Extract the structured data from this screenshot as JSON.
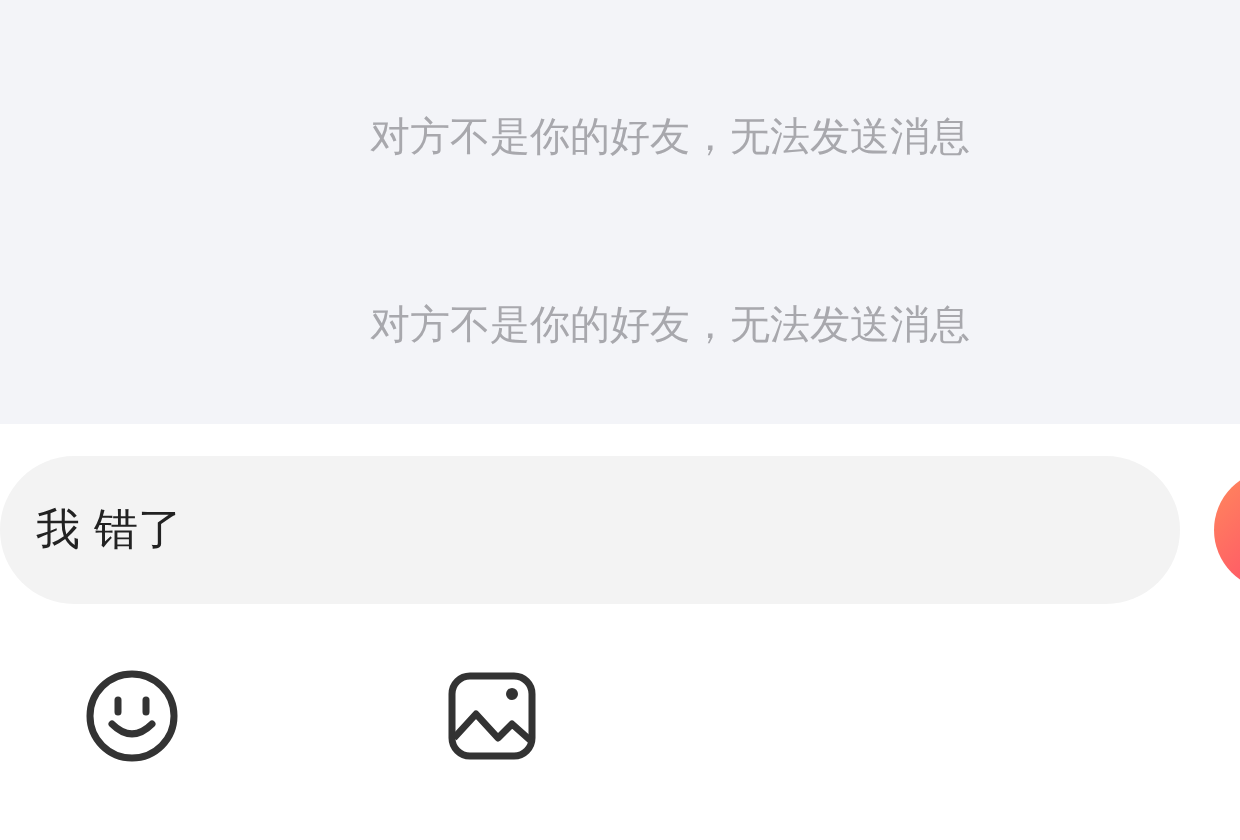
{
  "messages": [
    {
      "text": "对方不是你的好友，无法发送消息"
    },
    {
      "text": "对方不是你的好友，无法发送消息"
    }
  ],
  "input": {
    "value": "我 错了"
  }
}
